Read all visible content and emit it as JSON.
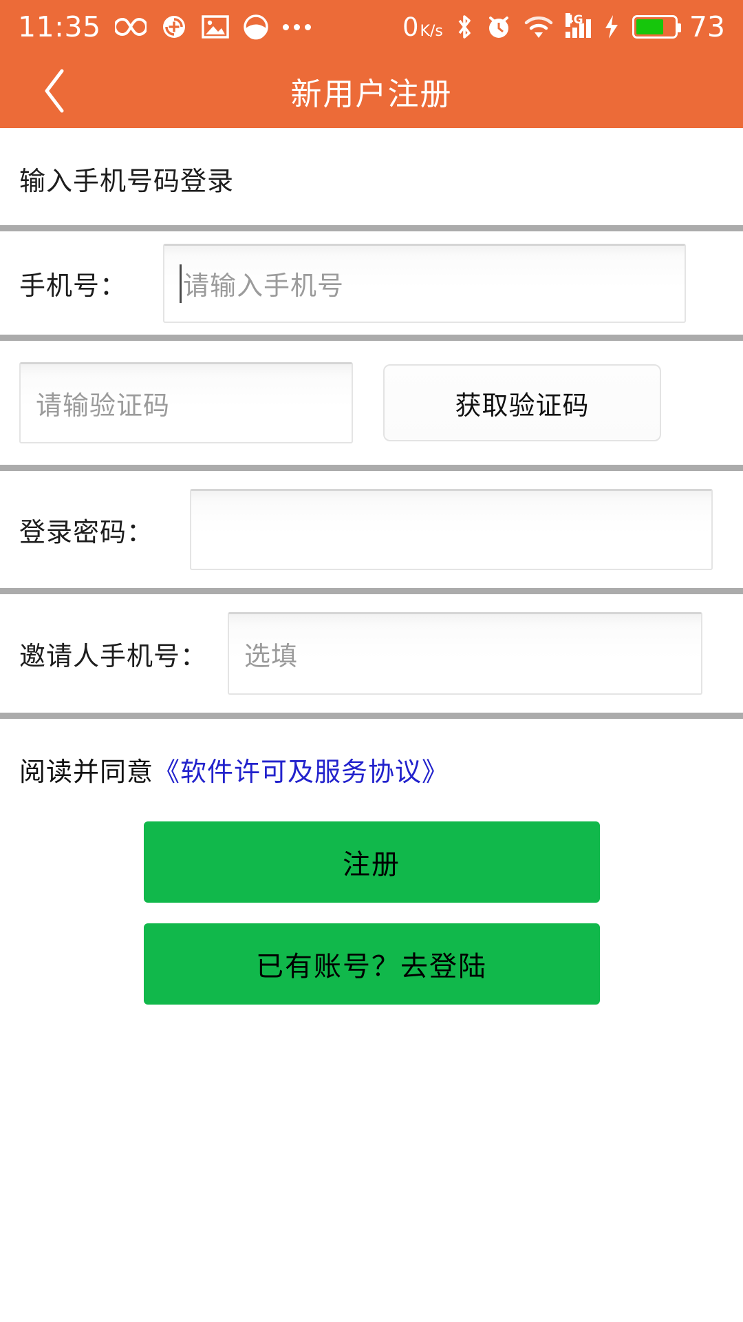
{
  "colors": {
    "orange": "#EC6B38",
    "green": "#11B84B",
    "battery_green": "#16C60C",
    "link_blue": "#2222CC",
    "divider_gray": "#ABABAB"
  },
  "status_bar": {
    "time": "11:35",
    "left_icons": [
      "infinity-icon",
      "sync-plus-icon",
      "image-icon",
      "half-circle-icon",
      "more-dots-icon"
    ],
    "network_speed": "0",
    "network_speed_unit_top": "K",
    "network_speed_unit_bottom": "s",
    "right_icons": [
      "bluetooth-icon",
      "alarm-clock-icon",
      "wifi-icon",
      "signal-bars-icon",
      "charging-bolt-icon",
      "battery-icon"
    ],
    "network_type": "4G",
    "battery_level": "73"
  },
  "header": {
    "back_label": "back",
    "title": "新用户注册"
  },
  "form": {
    "section_title": "输入手机号码登录",
    "phone": {
      "label": "手机号：",
      "placeholder": "请输入手机号",
      "value": ""
    },
    "captcha": {
      "placeholder": "请输验证码",
      "value": "",
      "button_label": "获取验证码"
    },
    "password": {
      "label": "登录密码：",
      "placeholder": "",
      "value": ""
    },
    "inviter": {
      "label": "邀请人手机号：",
      "placeholder": "选填",
      "value": ""
    }
  },
  "agreement": {
    "prefix": "阅读并同意",
    "link_text": "《软件许可及服务协议》"
  },
  "actions": {
    "register_label": "注册",
    "go_login_label": "已有账号？去登陆"
  }
}
